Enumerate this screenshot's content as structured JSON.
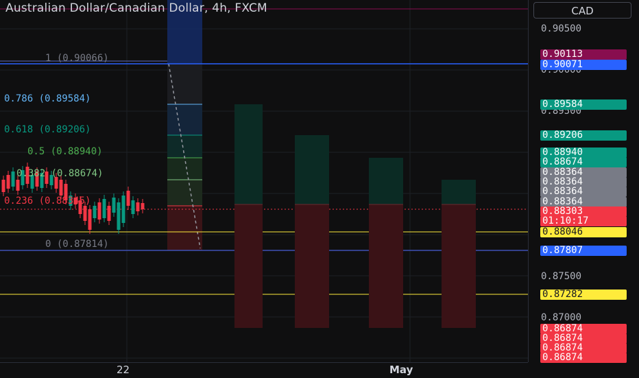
{
  "title": "Australian Dollar/Canadian Dollar, 4h, FXCM",
  "currency_button": "CAD",
  "fib_levels": [
    {
      "label": "1 (0.90066)",
      "color": "#787b86"
    },
    {
      "label": "0.786 (0.89584)",
      "color": "#64b5f6"
    },
    {
      "label": "0.618 (0.89206)",
      "color": "#089981"
    },
    {
      "label": "0.5 (0.88940)",
      "color": "#4caf50"
    },
    {
      "label": "0.382 (0.88674)",
      "color": "#81c784"
    },
    {
      "label": "0.236 (0.88345)",
      "color": "#f23645"
    },
    {
      "label": "0 (0.87814)",
      "color": "#787b86"
    }
  ],
  "price_axis": {
    "ticks": [
      "0.90500",
      "0.90000",
      "0.89500",
      "0.87500",
      "0.87000"
    ],
    "tags": [
      {
        "value": "0.90113",
        "color": "#880e4f"
      },
      {
        "value": "0.90071",
        "color": "#2962ff"
      },
      {
        "value": "0.89584",
        "color": "#089981"
      },
      {
        "value": "0.89206",
        "color": "#089981"
      },
      {
        "value": "0.88940",
        "color": "#089981"
      },
      {
        "value": "0.88674",
        "color": "#089981"
      },
      {
        "value": "0.88364",
        "color": "#787b86"
      },
      {
        "value": "0.88364",
        "color": "#787b86"
      },
      {
        "value": "0.88364",
        "color": "#787b86"
      },
      {
        "value": "0.88364",
        "color": "#787b86"
      },
      {
        "value": "0.88303",
        "color": "#f23645"
      },
      {
        "value": "01:10:17",
        "color": "#f23645"
      },
      {
        "value": "0.88046",
        "color": "#ffeb3b"
      },
      {
        "value": "0.87807",
        "color": "#2962ff"
      },
      {
        "value": "0.87282",
        "color": "#ffeb3b"
      },
      {
        "value": "0.86874",
        "color": "#f23645"
      },
      {
        "value": "0.86874",
        "color": "#f23645"
      },
      {
        "value": "0.86874",
        "color": "#f23645"
      },
      {
        "value": "0.86874",
        "color": "#f23645"
      }
    ]
  },
  "time_axis": [
    "22",
    "May"
  ],
  "colors": {
    "up": "#089981",
    "down": "#f23645",
    "bg": "#0f0f10"
  }
}
